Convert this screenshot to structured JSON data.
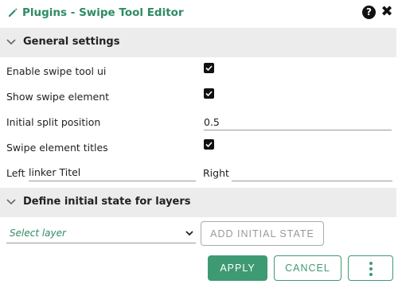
{
  "window": {
    "title": "Plugins - Swipe Tool Editor",
    "help_label": "?",
    "close_label": "✖"
  },
  "colors": {
    "accent": "#3e9a73",
    "title_green": "#2e8b64",
    "section_bg": "#ececec"
  },
  "general_settings": {
    "title": "General settings",
    "enable_ui_label": "Enable swipe tool ui",
    "enable_ui_checked": true,
    "show_element_label": "Show swipe element",
    "show_element_checked": true,
    "split_position_label": "Initial split position",
    "split_position_value": "0.5",
    "titles_label": "Swipe element titles",
    "titles_checked": true,
    "left_label": "Left",
    "left_value": "linker Titel",
    "right_label": "Right",
    "right_value": ""
  },
  "layers_section": {
    "title": "Define initial state for layers",
    "select_placeholder": "Select layer",
    "add_button_label": "ADD INITIAL STATE"
  },
  "footer": {
    "apply_label": "APPLY",
    "cancel_label": "CANCEL",
    "more_icon": "vertical-ellipsis-icon"
  }
}
